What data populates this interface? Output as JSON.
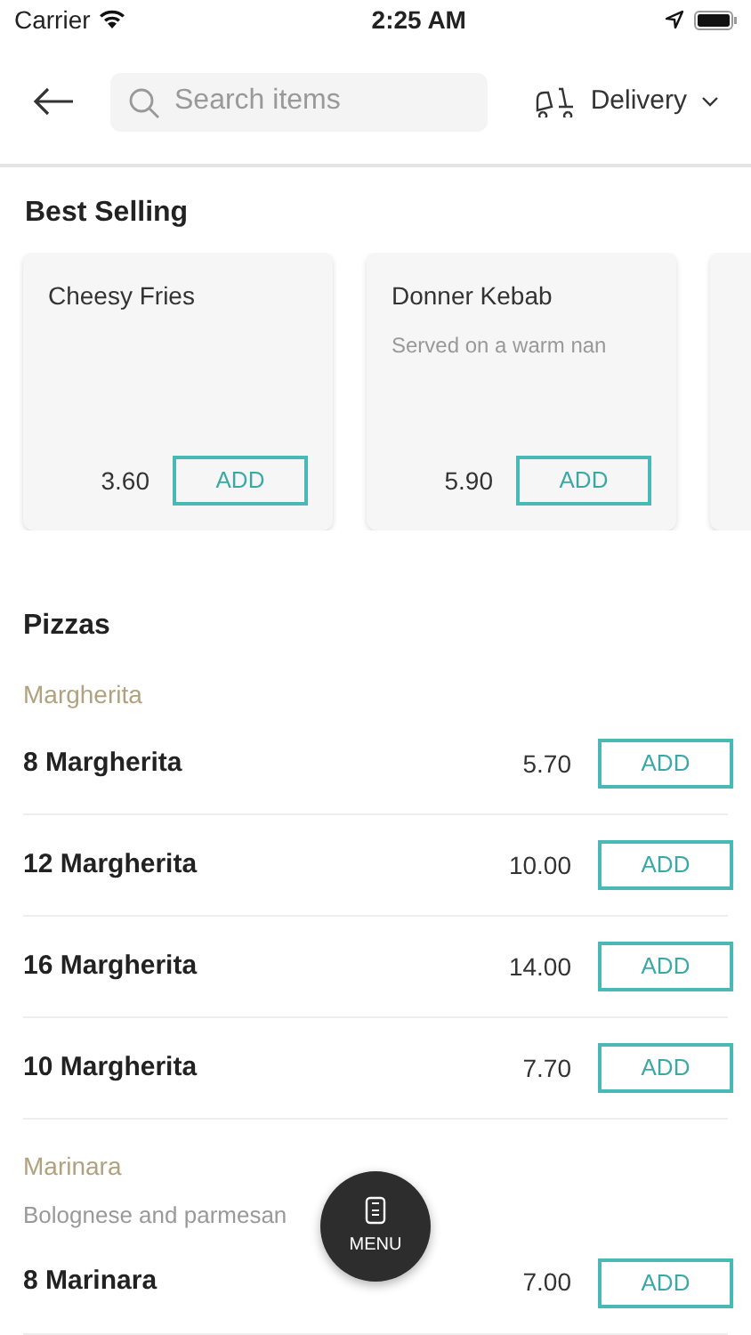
{
  "status_bar": {
    "carrier": "Carrier",
    "time": "2:25 AM"
  },
  "header": {
    "search": {
      "placeholder": "Search items"
    },
    "mode": "Delivery"
  },
  "best_selling": {
    "title": "Best Selling",
    "cards": [
      {
        "name": "Cheesy Fries",
        "price": "3.60",
        "button": "ADD"
      },
      {
        "name": "Donner Kebab",
        "description": "Served on a warm nan",
        "price": "5.90",
        "button": "ADD"
      }
    ]
  },
  "section": {
    "title": "Pizzas",
    "groups": [
      {
        "name": "Margherita",
        "items": [
          {
            "name": "8 Margherita",
            "price": "5.70",
            "button": "ADD"
          },
          {
            "name": "12 Margherita",
            "price": "10.00",
            "button": "ADD"
          },
          {
            "name": "16 Margherita",
            "price": "14.00",
            "button": "ADD"
          },
          {
            "name": "10 Margherita",
            "price": "7.70",
            "button": "ADD"
          }
        ]
      },
      {
        "name": "Marinara",
        "description": "Bolognese and parmesan",
        "items": [
          {
            "name": "8 Marinara",
            "price": "7.00",
            "button": "ADD"
          }
        ]
      }
    ]
  },
  "menu_button": "MENU"
}
